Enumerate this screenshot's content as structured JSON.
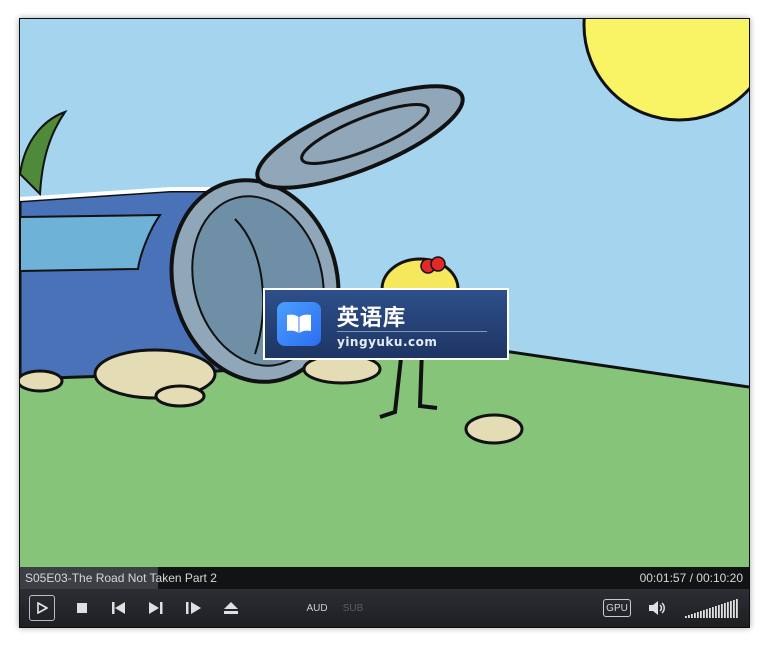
{
  "watermark": {
    "title": "英语库",
    "subtitle": "yingyuku.com"
  },
  "status": {
    "title": "S05E03-The Road Not Taken Part 2",
    "time": "00:01:57 / 00:10:20",
    "progress_fraction": 0.189
  },
  "controls": {
    "aud_label": "AUD",
    "sub_label": "SUB",
    "gpu_label": "GPU",
    "volume_fraction": 1.0,
    "icons": [
      "play-icon",
      "stop-icon",
      "previous-icon",
      "next-icon",
      "frame-step-icon",
      "eject-icon",
      "volume-icon",
      "volume-level-icon"
    ]
  },
  "colors": {
    "sky": "#a5d4ef",
    "grass": "#86c47a",
    "can": "#4a72b8",
    "sun": "#f8f466",
    "bar": "#1d1f23"
  }
}
